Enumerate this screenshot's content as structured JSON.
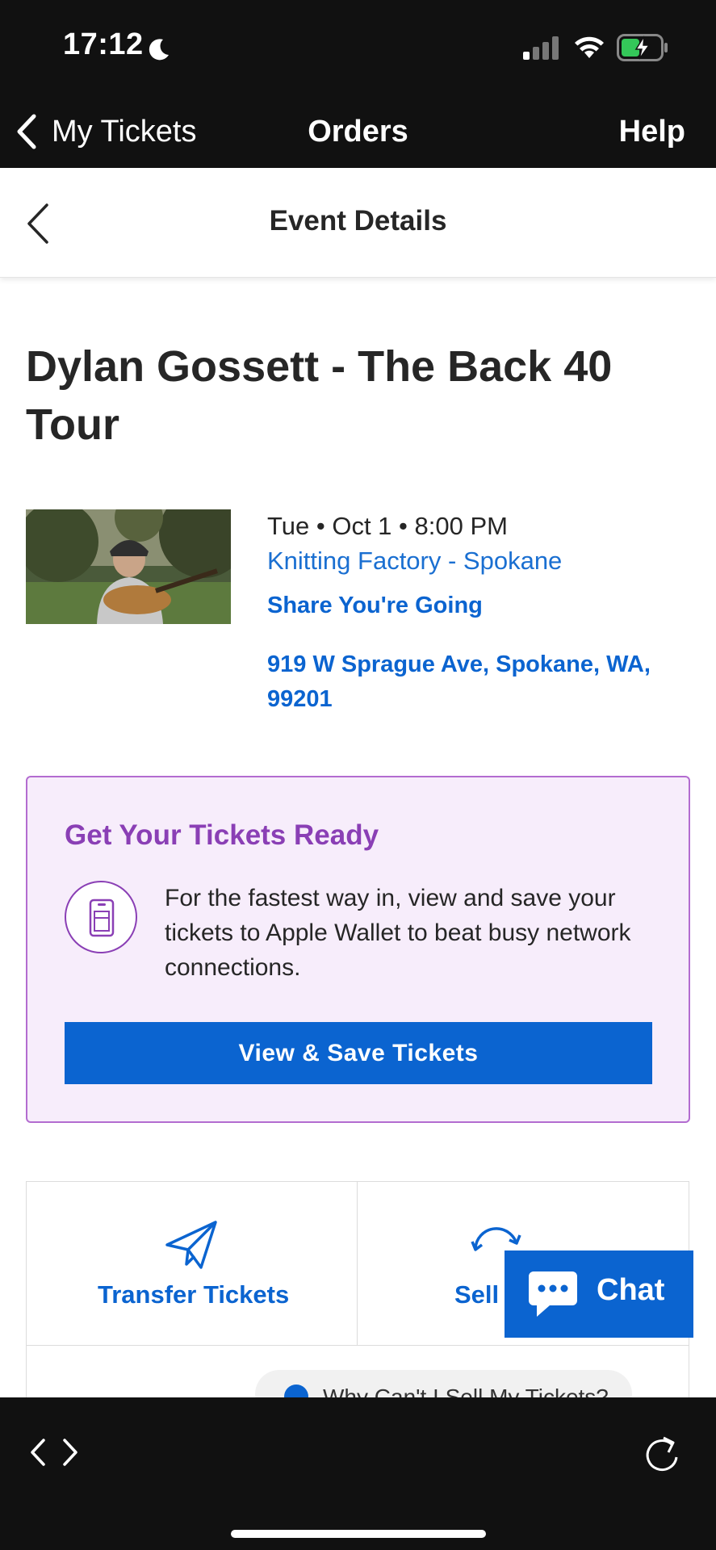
{
  "status_bar": {
    "time": "17:12"
  },
  "nav": {
    "back_label": "My Tickets",
    "title": "Orders",
    "help_label": "Help"
  },
  "sub_header": {
    "title": "Event Details"
  },
  "event": {
    "title": "Dylan Gossett - The Back 40 Tour",
    "date": "Tue • Oct 1 • 8:00 PM",
    "venue": "Knitting Factory - Spokane",
    "share_label": "Share You're Going",
    "address": "919 W Sprague Ave, Spokane, WA, 99201"
  },
  "ready_card": {
    "title": "Get Your Tickets Ready",
    "text": "For the fastest way in, view and save your tickets to Apple Wallet to beat busy network connections.",
    "button_label": "View & Save Tickets"
  },
  "actions": {
    "transfer_label": "Transfer Tickets",
    "sell_label": "Sell",
    "why_label": "Why Can't I Sell My Tickets?"
  },
  "chat": {
    "label": "Chat"
  },
  "colors": {
    "brand_blue": "#0b64d0",
    "card_purple": "#8a3fb5",
    "card_bg": "#f7edfb",
    "bar_bg": "#111111"
  },
  "icons": [
    "moon-icon",
    "signal-icon",
    "wifi-icon",
    "battery-icon",
    "chevron-left-icon",
    "wallet-phone-icon",
    "paper-plane-icon",
    "sell-cycle-icon",
    "chat-bubble-icon",
    "info-icon",
    "reload-icon"
  ]
}
